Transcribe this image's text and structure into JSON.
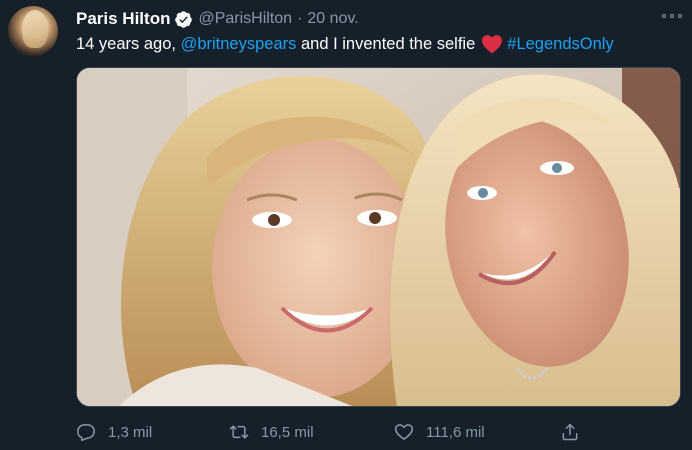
{
  "tweet": {
    "author_name": "Paris Hilton",
    "handle": "@ParisHilton",
    "separator": "·",
    "date": "20 nov.",
    "text_prefix": "14 years ago, ",
    "mention": "@britneyspears",
    "text_middle": " and I invented the selfie",
    "hashtag": "#LegendsOnly"
  },
  "stats": {
    "replies": "1,3 mil",
    "retweets": "16,5 mil",
    "likes": "111,6 mil"
  },
  "icons": {
    "verified": "verified-badge-icon",
    "more": "more-options-icon",
    "emoji": "red-heart-emoji",
    "reply": "reply-icon",
    "retweet": "retweet-icon",
    "like": "heart-icon",
    "share": "share-icon"
  },
  "colors": {
    "background": "#15202b",
    "text": "#ffffff",
    "muted": "#8899a6",
    "link": "#1da1f2",
    "heart": "#e0245e",
    "border": "#38444d"
  }
}
